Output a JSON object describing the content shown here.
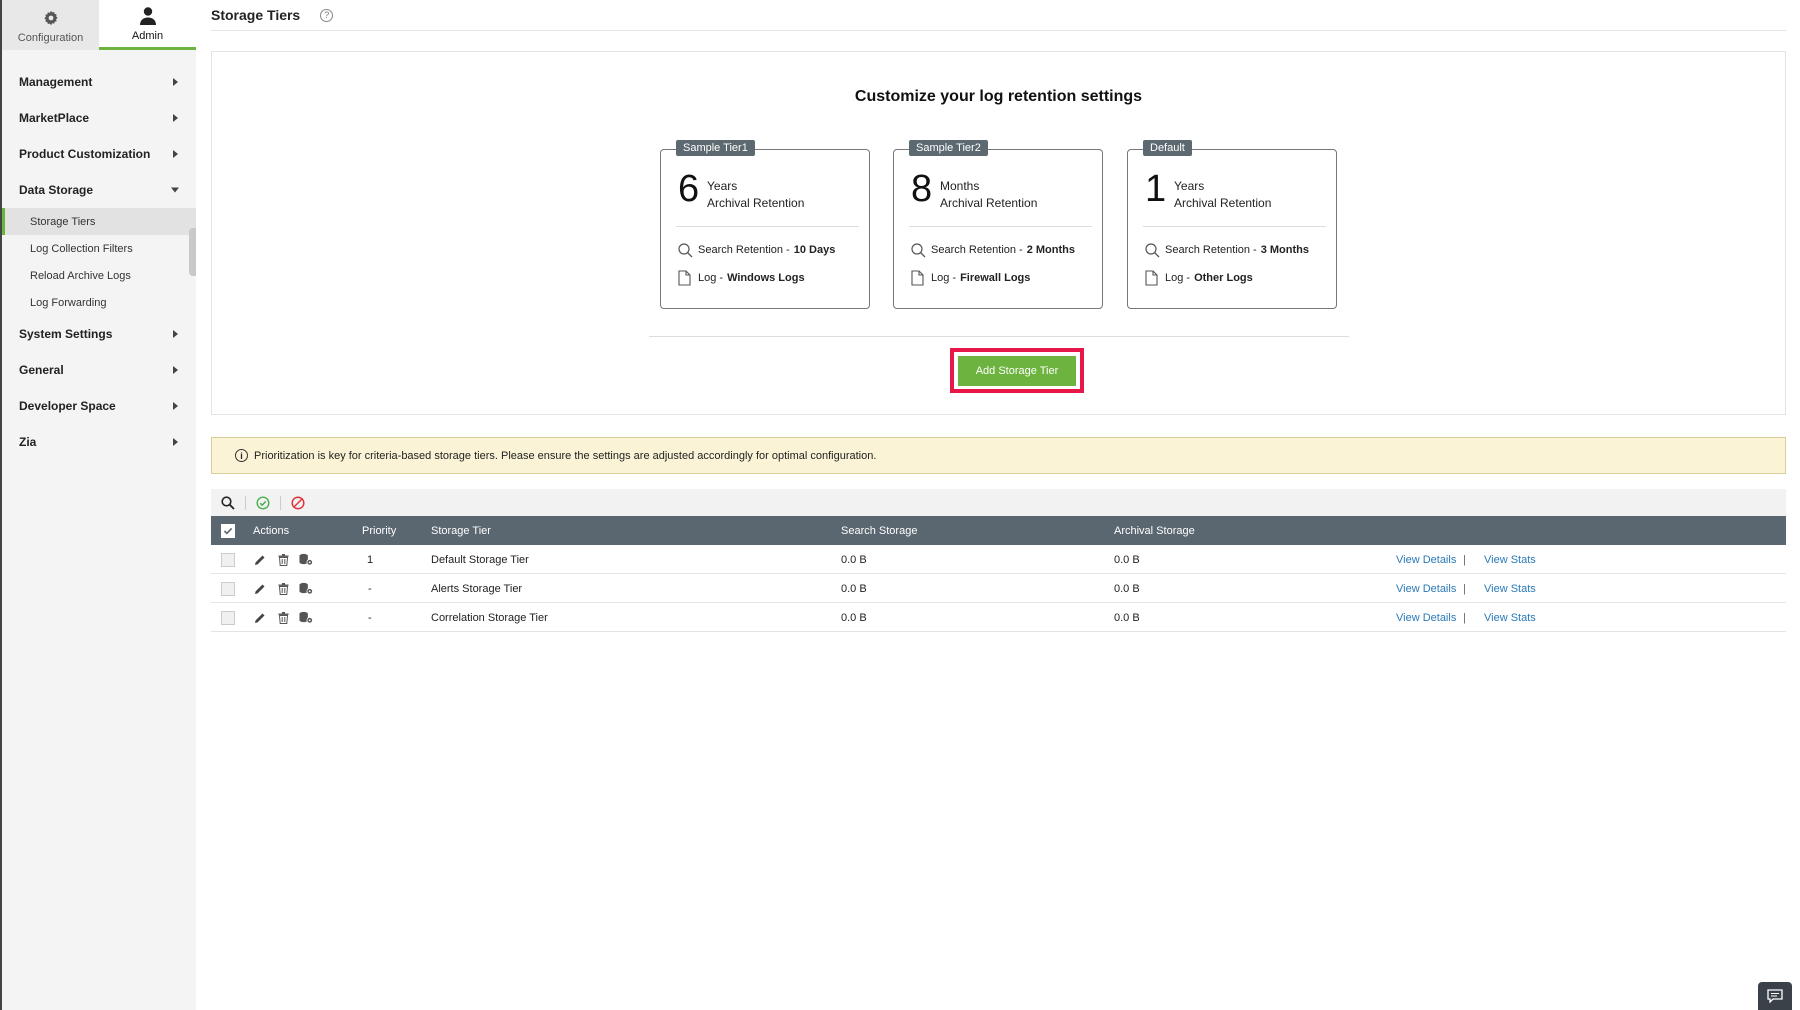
{
  "sidebar": {
    "tabs": [
      {
        "label": "Configuration",
        "icon": "gear-icon",
        "active": false
      },
      {
        "label": "Admin",
        "icon": "user-icon",
        "active": true
      }
    ],
    "groups": {
      "management": "Management",
      "marketplace": "MarketPlace",
      "product_customization": "Product Customization",
      "data_storage": "Data Storage",
      "system_settings": "System Settings",
      "general": "General",
      "developer_space": "Developer Space",
      "zia": "Zia"
    },
    "data_storage_items": [
      "Storage Tiers",
      "Log Collection Filters",
      "Reload Archive Logs",
      "Log Forwarding"
    ]
  },
  "page": {
    "title": "Storage Tiers",
    "help_glyph": "?"
  },
  "config": {
    "heading": "Customize your log retention settings",
    "tiers": [
      {
        "badge": "Sample Tier1",
        "number": "6",
        "unit": "Years",
        "retention_label": "Archival Retention",
        "search_label": "Search Retention -",
        "search_value": "10 Days",
        "log_label": "Log -",
        "log_value": "Windows Logs"
      },
      {
        "badge": "Sample Tier2",
        "number": "8",
        "unit": "Months",
        "retention_label": "Archival Retention",
        "search_label": "Search Retention -",
        "search_value": "2 Months",
        "log_label": "Log -",
        "log_value": "Firewall Logs"
      },
      {
        "badge": "Default",
        "number": "1",
        "unit": "Years",
        "retention_label": "Archival Retention",
        "search_label": "Search Retention -",
        "search_value": "3 Months",
        "log_label": "Log -",
        "log_value": "Other Logs"
      }
    ],
    "add_button": "Add Storage Tier"
  },
  "info": {
    "glyph": "i",
    "text": "Prioritization is key for criteria-based storage tiers. Please ensure the settings are adjusted accordingly for optimal configuration."
  },
  "table": {
    "headers": {
      "actions": "Actions",
      "priority": "Priority",
      "storage_tier": "Storage Tier",
      "search_storage": "Search Storage",
      "archival_storage": "Archival Storage"
    },
    "rows": [
      {
        "priority": "1",
        "tier": "Default Storage Tier",
        "search": "0.0 B",
        "archival": "0.0 B",
        "details": "View Details",
        "sep": "|",
        "stats": "View Stats"
      },
      {
        "priority": "-",
        "tier": "Alerts Storage Tier",
        "search": "0.0 B",
        "archival": "0.0 B",
        "details": "View Details",
        "sep": "|",
        "stats": "View Stats"
      },
      {
        "priority": "-",
        "tier": "Correlation Storage Tier",
        "search": "0.0 B",
        "archival": "0.0 B",
        "details": "View Details",
        "sep": "|",
        "stats": "View Stats"
      }
    ]
  },
  "colors": {
    "accent": "#6cb33f",
    "highlight": "#e8174a",
    "link": "#2a7ab8",
    "table_header": "#5a6670",
    "info_bg": "#faf3d6"
  }
}
